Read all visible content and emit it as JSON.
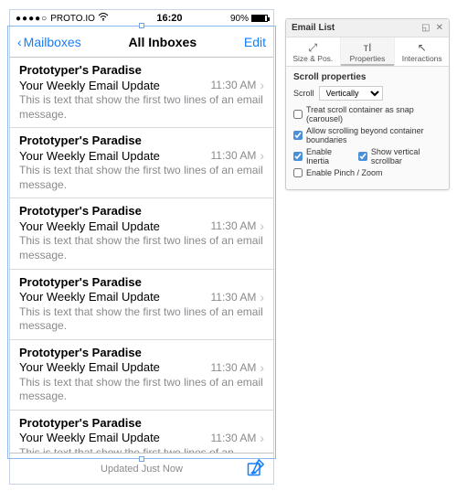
{
  "status": {
    "dots": "●●●●○",
    "carrier": "PROTO.IO",
    "wifi": "⊿",
    "time": "16:20",
    "battery_pct": "90%"
  },
  "nav": {
    "back_label": "Mailboxes",
    "title": "All Inboxes",
    "edit_label": "Edit"
  },
  "emails": [
    {
      "sender": "Prototyper's Paradise",
      "subject": "Your Weekly Email Update",
      "time": "11:30 AM",
      "preview": "This is text that show the first two lines of an email message."
    },
    {
      "sender": "Prototyper's Paradise",
      "subject": "Your Weekly Email Update",
      "time": "11:30 AM",
      "preview": "This is text that show the first two lines of an email message."
    },
    {
      "sender": "Prototyper's Paradise",
      "subject": "Your Weekly Email Update",
      "time": "11:30 AM",
      "preview": "This is text that show the first two lines of an email message."
    },
    {
      "sender": "Prototyper's Paradise",
      "subject": "Your Weekly Email Update",
      "time": "11:30 AM",
      "preview": "This is text that show the first two lines of an email message."
    },
    {
      "sender": "Prototyper's Paradise",
      "subject": "Your Weekly Email Update",
      "time": "11:30 AM",
      "preview": "This is text that show the first two lines of an email message."
    },
    {
      "sender": "Prototyper's Paradise",
      "subject": "Your Weekly Email Update",
      "time": "11:30 AM",
      "preview": "This is text that show the first two lines of an"
    }
  ],
  "toolbar": {
    "updated": "Updated Just Now"
  },
  "panel": {
    "title": "Email List",
    "tabs": {
      "size": "Size & Pos.",
      "props": "Properties",
      "inter": "Interactions"
    },
    "section": "Scroll properties",
    "scroll_label": "Scroll",
    "scroll_value": "Vertically",
    "opt_snap": "Treat scroll container as snap (carousel)",
    "opt_beyond": "Allow scrolling beyond container boundaries",
    "opt_inertia": "Enable Inertia",
    "opt_scrollbar": "Show vertical scrollbar",
    "opt_pinch": "Enable Pinch / Zoom",
    "checked": {
      "snap": false,
      "beyond": true,
      "inertia": true,
      "scrollbar": true,
      "pinch": false
    }
  }
}
